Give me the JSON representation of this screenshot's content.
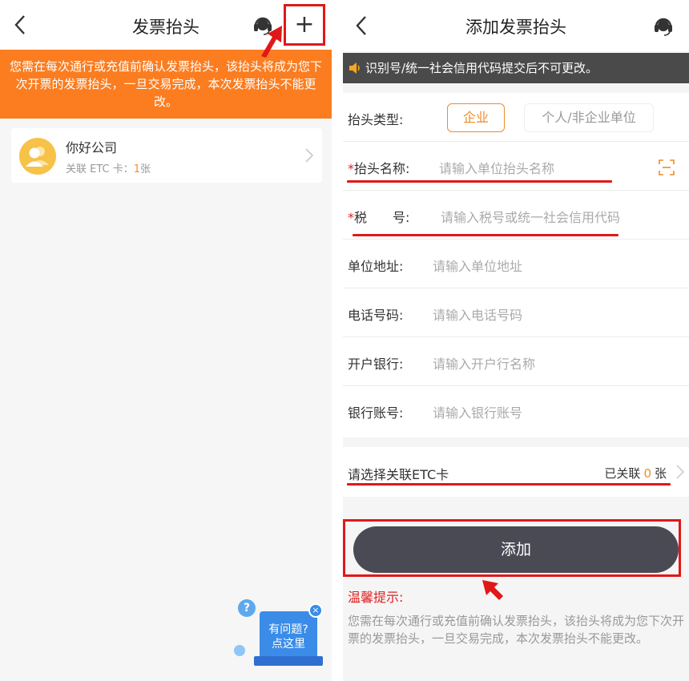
{
  "left": {
    "nav": {
      "title": "发票抬头"
    },
    "banner": "您需在每次通行或充值前确认发票抬头，该抬头将成为您下次开票的发票抬头，一旦交易完成，本次发票抬头不能更改。",
    "company": {
      "name": "你好公司",
      "linked_prefix": "关联 ETC 卡：",
      "linked_count": "1",
      "linked_suffix": "张"
    },
    "help_widget": {
      "badge": "?",
      "line1": "有问题?",
      "line2": "点这里",
      "close": "×"
    },
    "add_icon": "+"
  },
  "right": {
    "nav": {
      "title": "添加发票抬头"
    },
    "notice": "识别号/统一社会信用代码提交后不可更改。",
    "form": {
      "type_label": "抬头类型:",
      "type_options": [
        "企业",
        "个人/非企业单位"
      ],
      "name_star": "*",
      "name_label": "抬头名称:",
      "name_placeholder": "请输入单位抬头名称",
      "tax_star": "*",
      "tax_label": "税　　号:",
      "tax_placeholder": "请输入税号或统一社会信用代码",
      "address_label": "单位地址:",
      "address_placeholder": "请输入单位地址",
      "phone_label": "电话号码:",
      "phone_placeholder": "请输入电话号码",
      "bank_label": "开户银行:",
      "bank_placeholder": "请输入开户行名称",
      "account_label": "银行账号:",
      "account_placeholder": "请输入银行账号"
    },
    "etc": {
      "label": "请选择关联ETC卡",
      "linked_prefix": "已关联",
      "linked_count": "0",
      "linked_suffix": "张"
    },
    "add_button": "添加",
    "tips_title": "温馨提示:",
    "tips_body": "您需在每次通行或充值前确认发票抬头，该抬头将成为您下次开票的发票抬头，一旦交易完成，本次发票抬头不能更改。"
  },
  "colors": {
    "orange_banner": "#fb7d20",
    "accent_orange": "#f08a2a",
    "annotation_red": "#e01818",
    "dark_button": "#4a4a55",
    "notice_bg": "#4a4a4a"
  }
}
